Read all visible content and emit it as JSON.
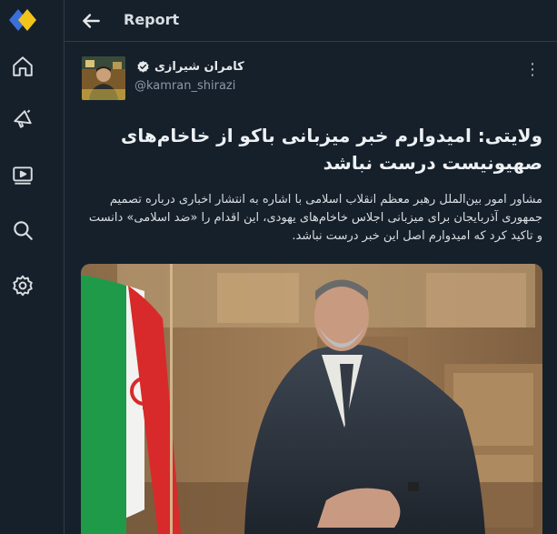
{
  "app": {
    "header_title": "Report",
    "colors": {
      "bg": "#15202b",
      "accent_blue": "#2f6fdc",
      "accent_yellow": "#f0c419",
      "verified": "#e7e9ea"
    }
  },
  "sidebar": {
    "items": [
      {
        "icon": "home-icon"
      },
      {
        "icon": "megaphone-icon"
      },
      {
        "icon": "video-icon"
      },
      {
        "icon": "search-icon"
      },
      {
        "icon": "gear-icon"
      }
    ]
  },
  "post": {
    "author_name": "کامران شیرازی",
    "author_handle": "@kamran_shirazi",
    "more_label": "⋮",
    "headline": "ولایتی: امیدوارم خبر میزبانی باکو از خاخام‌های صهیونیست درست نباشد",
    "body": "مشاور امور بین‌الملل رهبر معظم انقلاب اسلامی با اشاره به انتشار اخباری درباره تصمیم جمهوری آذربایجان برای میزبانی اجلاس خاخام‌های یهودی، این اقدام را «ضد اسلامی» دانست و تاکید کرد که امیدوارم اصل این خبر درست نباشد."
  }
}
